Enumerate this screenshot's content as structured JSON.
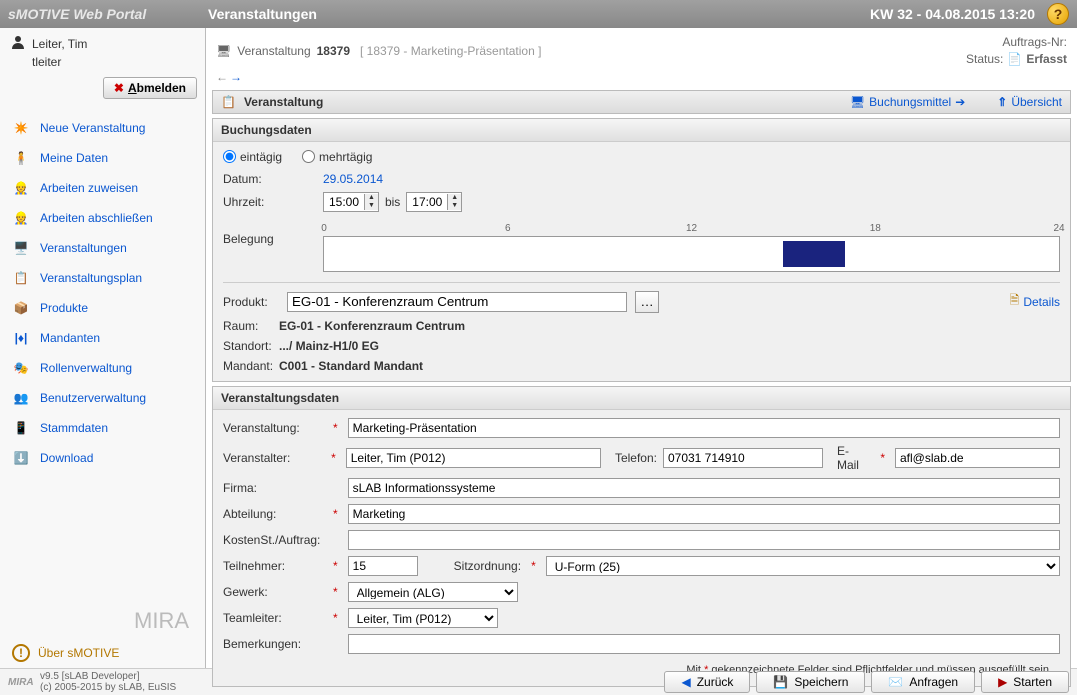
{
  "app_title": "sMOTIVE Web Portal",
  "module_title": "Veranstaltungen",
  "timestamp": "KW 32 - 04.08.2015 13:20",
  "user": {
    "name": "Leiter, Tim",
    "login": "tleiter"
  },
  "logout_label": "Abmelden",
  "nav": [
    {
      "label": "Neue Veranstaltung"
    },
    {
      "label": "Meine Daten"
    },
    {
      "label": "Arbeiten zuweisen"
    },
    {
      "label": "Arbeiten abschließen"
    },
    {
      "label": "Veranstaltungen"
    },
    {
      "label": "Veranstaltungsplan"
    },
    {
      "label": "Produkte"
    },
    {
      "label": "Mandanten"
    },
    {
      "label": "Rollenverwaltung"
    },
    {
      "label": "Benutzerverwaltung"
    },
    {
      "label": "Stammdaten"
    },
    {
      "label": "Download"
    }
  ],
  "brand": "MIRA",
  "about_label": "Über sMOTIVE",
  "footer": {
    "version": "v9.5 [sLAB Developer]",
    "copyright": "(c) 2005-2015 by sLAB, EuSIS",
    "back": "Zurück",
    "save": "Speichern",
    "request": "Anfragen",
    "start": "Starten"
  },
  "crumb": {
    "label": "Veranstaltung",
    "number": "18379",
    "sub": "[ 18379 - Marketing-Präsentation ]",
    "order_label": "Auftrags-Nr:",
    "status_label": "Status:",
    "status_value": "Erfasst"
  },
  "section": {
    "title": "Veranstaltung",
    "link_book": "Buchungsmittel",
    "link_overview": "Übersicht"
  },
  "booking": {
    "title": "Buchungsdaten",
    "single": "eintägig",
    "multi": "mehrtägig",
    "date_label": "Datum:",
    "date_value": "29.05.2014",
    "time_label": "Uhrzeit:",
    "time_from": "15:00",
    "time_sep": "bis",
    "time_to": "17:00",
    "occ_label": "Belegung",
    "ticks": [
      "0",
      "6",
      "12",
      "18",
      "24"
    ],
    "product_label": "Produkt:",
    "product_value": "EG-01 - Konferenzraum Centrum",
    "details": "Details",
    "room_label": "Raum:",
    "room_value": "EG-01 - Konferenzraum Centrum",
    "loc_label": "Standort:",
    "loc_value": ".../ Mainz-H1/0 EG",
    "mandant_label": "Mandant:",
    "mandant_value": "C001 - Standard Mandant"
  },
  "event": {
    "title": "Veranstaltungsdaten",
    "name_label": "Veranstaltung:",
    "name_value": "Marketing-Präsentation",
    "org_label": "Veranstalter:",
    "org_value": "Leiter, Tim (P012)",
    "phone_label": "Telefon:",
    "phone_value": "07031 714910",
    "email_label": "E-Mail",
    "email_value": "afl@slab.de",
    "firm_label": "Firma:",
    "firm_value": "sLAB Informationssysteme",
    "dept_label": "Abteilung:",
    "dept_value": "Marketing",
    "cost_label": "KostenSt./Auftrag:",
    "cost_value": "",
    "part_label": "Teilnehmer:",
    "part_value": "15",
    "seat_label": "Sitzordnung:",
    "seat_value": "U-Form (25)",
    "trade_label": "Gewerk:",
    "trade_value": "Allgemein (ALG)",
    "lead_label": "Teamleiter:",
    "lead_value": "Leiter, Tim (P012)",
    "remark_label": "Bemerkungen:",
    "remark_value": ""
  },
  "mand_note_1": "Mit ",
  "mand_note_2": " gekennzeichnete Felder sind Pflichtfelder und müssen ausgefüllt sein."
}
